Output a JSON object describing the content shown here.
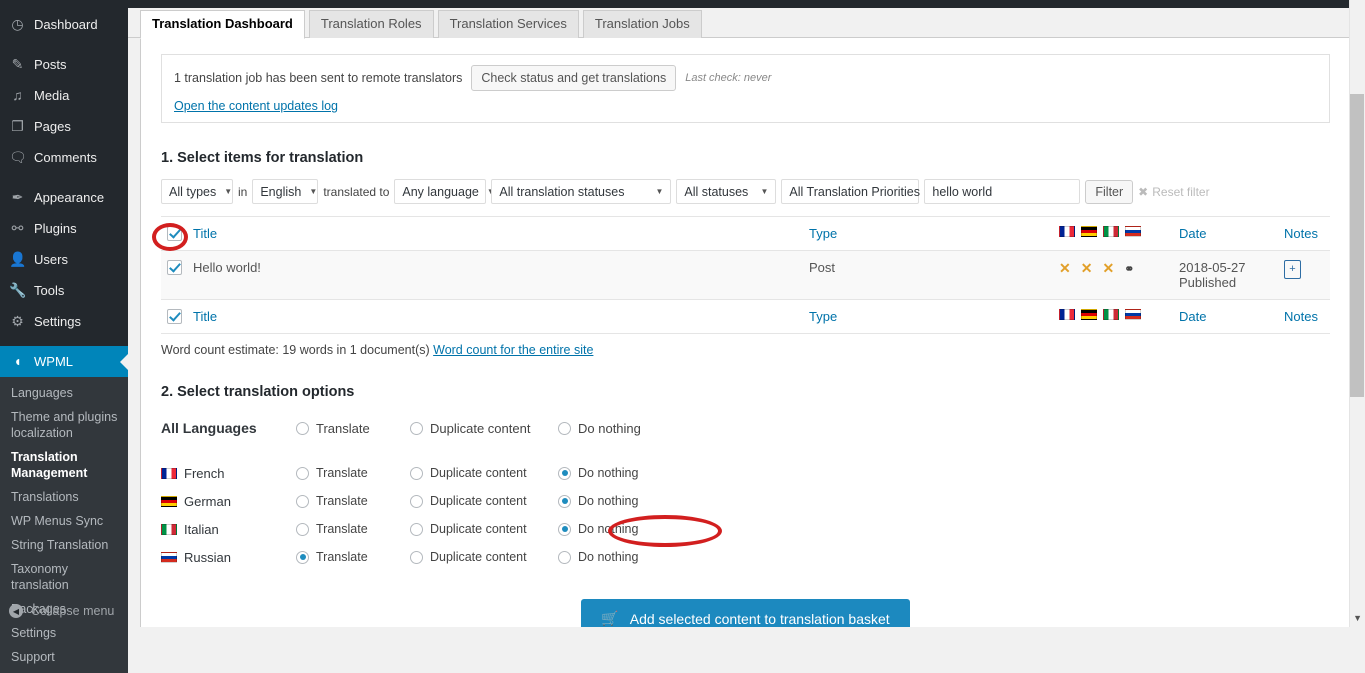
{
  "sidebar": {
    "items": [
      {
        "label": "Dashboard",
        "icon": "dashboard-icon",
        "glyph": "◷"
      },
      {
        "label": "Posts",
        "icon": "pin-icon",
        "glyph": "✎"
      },
      {
        "label": "Media",
        "icon": "media-icon",
        "glyph": "♪"
      },
      {
        "label": "Pages",
        "icon": "pages-icon",
        "glyph": "❐"
      },
      {
        "label": "Comments",
        "icon": "comments-icon",
        "glyph": "💬"
      },
      {
        "label": "Appearance",
        "icon": "brush-icon",
        "glyph": "✒"
      },
      {
        "label": "Plugins",
        "icon": "plug-icon",
        "glyph": "⚯"
      },
      {
        "label": "Users",
        "icon": "user-icon",
        "glyph": "👤"
      },
      {
        "label": "Tools",
        "icon": "wrench-icon",
        "glyph": "🔧"
      },
      {
        "label": "Settings",
        "icon": "sliders-icon",
        "glyph": "⚙"
      }
    ],
    "current": {
      "label": "WPML",
      "icon": "wpml-icon",
      "glyph": "Q"
    },
    "submenu": [
      {
        "label": "Languages",
        "active": false
      },
      {
        "label": "Theme and plugins localization",
        "active": false
      },
      {
        "label": "Translation Management",
        "active": true
      },
      {
        "label": "Translations",
        "active": false
      },
      {
        "label": "WP Menus Sync",
        "active": false
      },
      {
        "label": "String Translation",
        "active": false
      },
      {
        "label": "Taxonomy translation",
        "active": false
      },
      {
        "label": "Packages",
        "active": false
      },
      {
        "label": "Settings",
        "active": false
      },
      {
        "label": "Support",
        "active": false
      }
    ],
    "collapse_label": "Collapse menu",
    "accent": "#0085ba"
  },
  "tabs": [
    {
      "label": "Translation Dashboard",
      "active": true
    },
    {
      "label": "Translation Roles",
      "active": false
    },
    {
      "label": "Translation Services",
      "active": false
    },
    {
      "label": "Translation Jobs",
      "active": false
    }
  ],
  "notice": {
    "message": "1 translation job has been sent to remote translators",
    "check_button": "Check status and get translations",
    "last_check": "Last check: never",
    "log_link": "Open the content updates log"
  },
  "step1": {
    "heading": "1. Select items for translation",
    "filters": {
      "types": "All types",
      "in_label": "in",
      "language": "English",
      "translated_to_label": "translated to",
      "target_language": "Any language",
      "translation_statuses": "All translation statuses",
      "statuses": "All statuses",
      "priorities": "All Translation Priorities",
      "search_value": "hello world",
      "search_placeholder": "",
      "filter_button": "Filter",
      "reset_label": "Reset filter"
    },
    "table": {
      "headers": {
        "title": "Title",
        "type": "Type",
        "date": "Date",
        "notes": "Notes"
      },
      "flags": [
        "French",
        "German",
        "Italian",
        "Russian"
      ],
      "row": {
        "checked": true,
        "title": "Hello world!",
        "type": "Post",
        "statuses": [
          "✕",
          "✕",
          "✕"
        ],
        "link_icon": "dumbbell-icon",
        "date": "2018-05-27",
        "state": "Published",
        "note_icon": "add-note-icon"
      },
      "header_checked": true
    },
    "word_count": "Word count estimate: 19 words in 1 document(s)",
    "word_count_link": "Word count for the entire site"
  },
  "step2": {
    "heading": "2. Select translation options",
    "columns": [
      "Translate",
      "Duplicate content",
      "Do nothing"
    ],
    "all_languages_label": "All Languages",
    "all_languages_selected": null,
    "rows": [
      {
        "language": "French",
        "flag": "fl-fr",
        "selected": "Do nothing"
      },
      {
        "language": "German",
        "flag": "fl-de",
        "selected": "Do nothing"
      },
      {
        "language": "Italian",
        "flag": "fl-it",
        "selected": "Do nothing"
      },
      {
        "language": "Russian",
        "flag": "fl-ru",
        "selected": "Translate"
      }
    ]
  },
  "cta": {
    "label": "Add selected content to translation basket",
    "icon": "cart-icon",
    "color": "#1c89bf"
  },
  "annotations": {
    "checkbox_oval": "red-oval-highlight",
    "radio_oval": "red-oval-highlight",
    "color": "#d21f1f"
  }
}
